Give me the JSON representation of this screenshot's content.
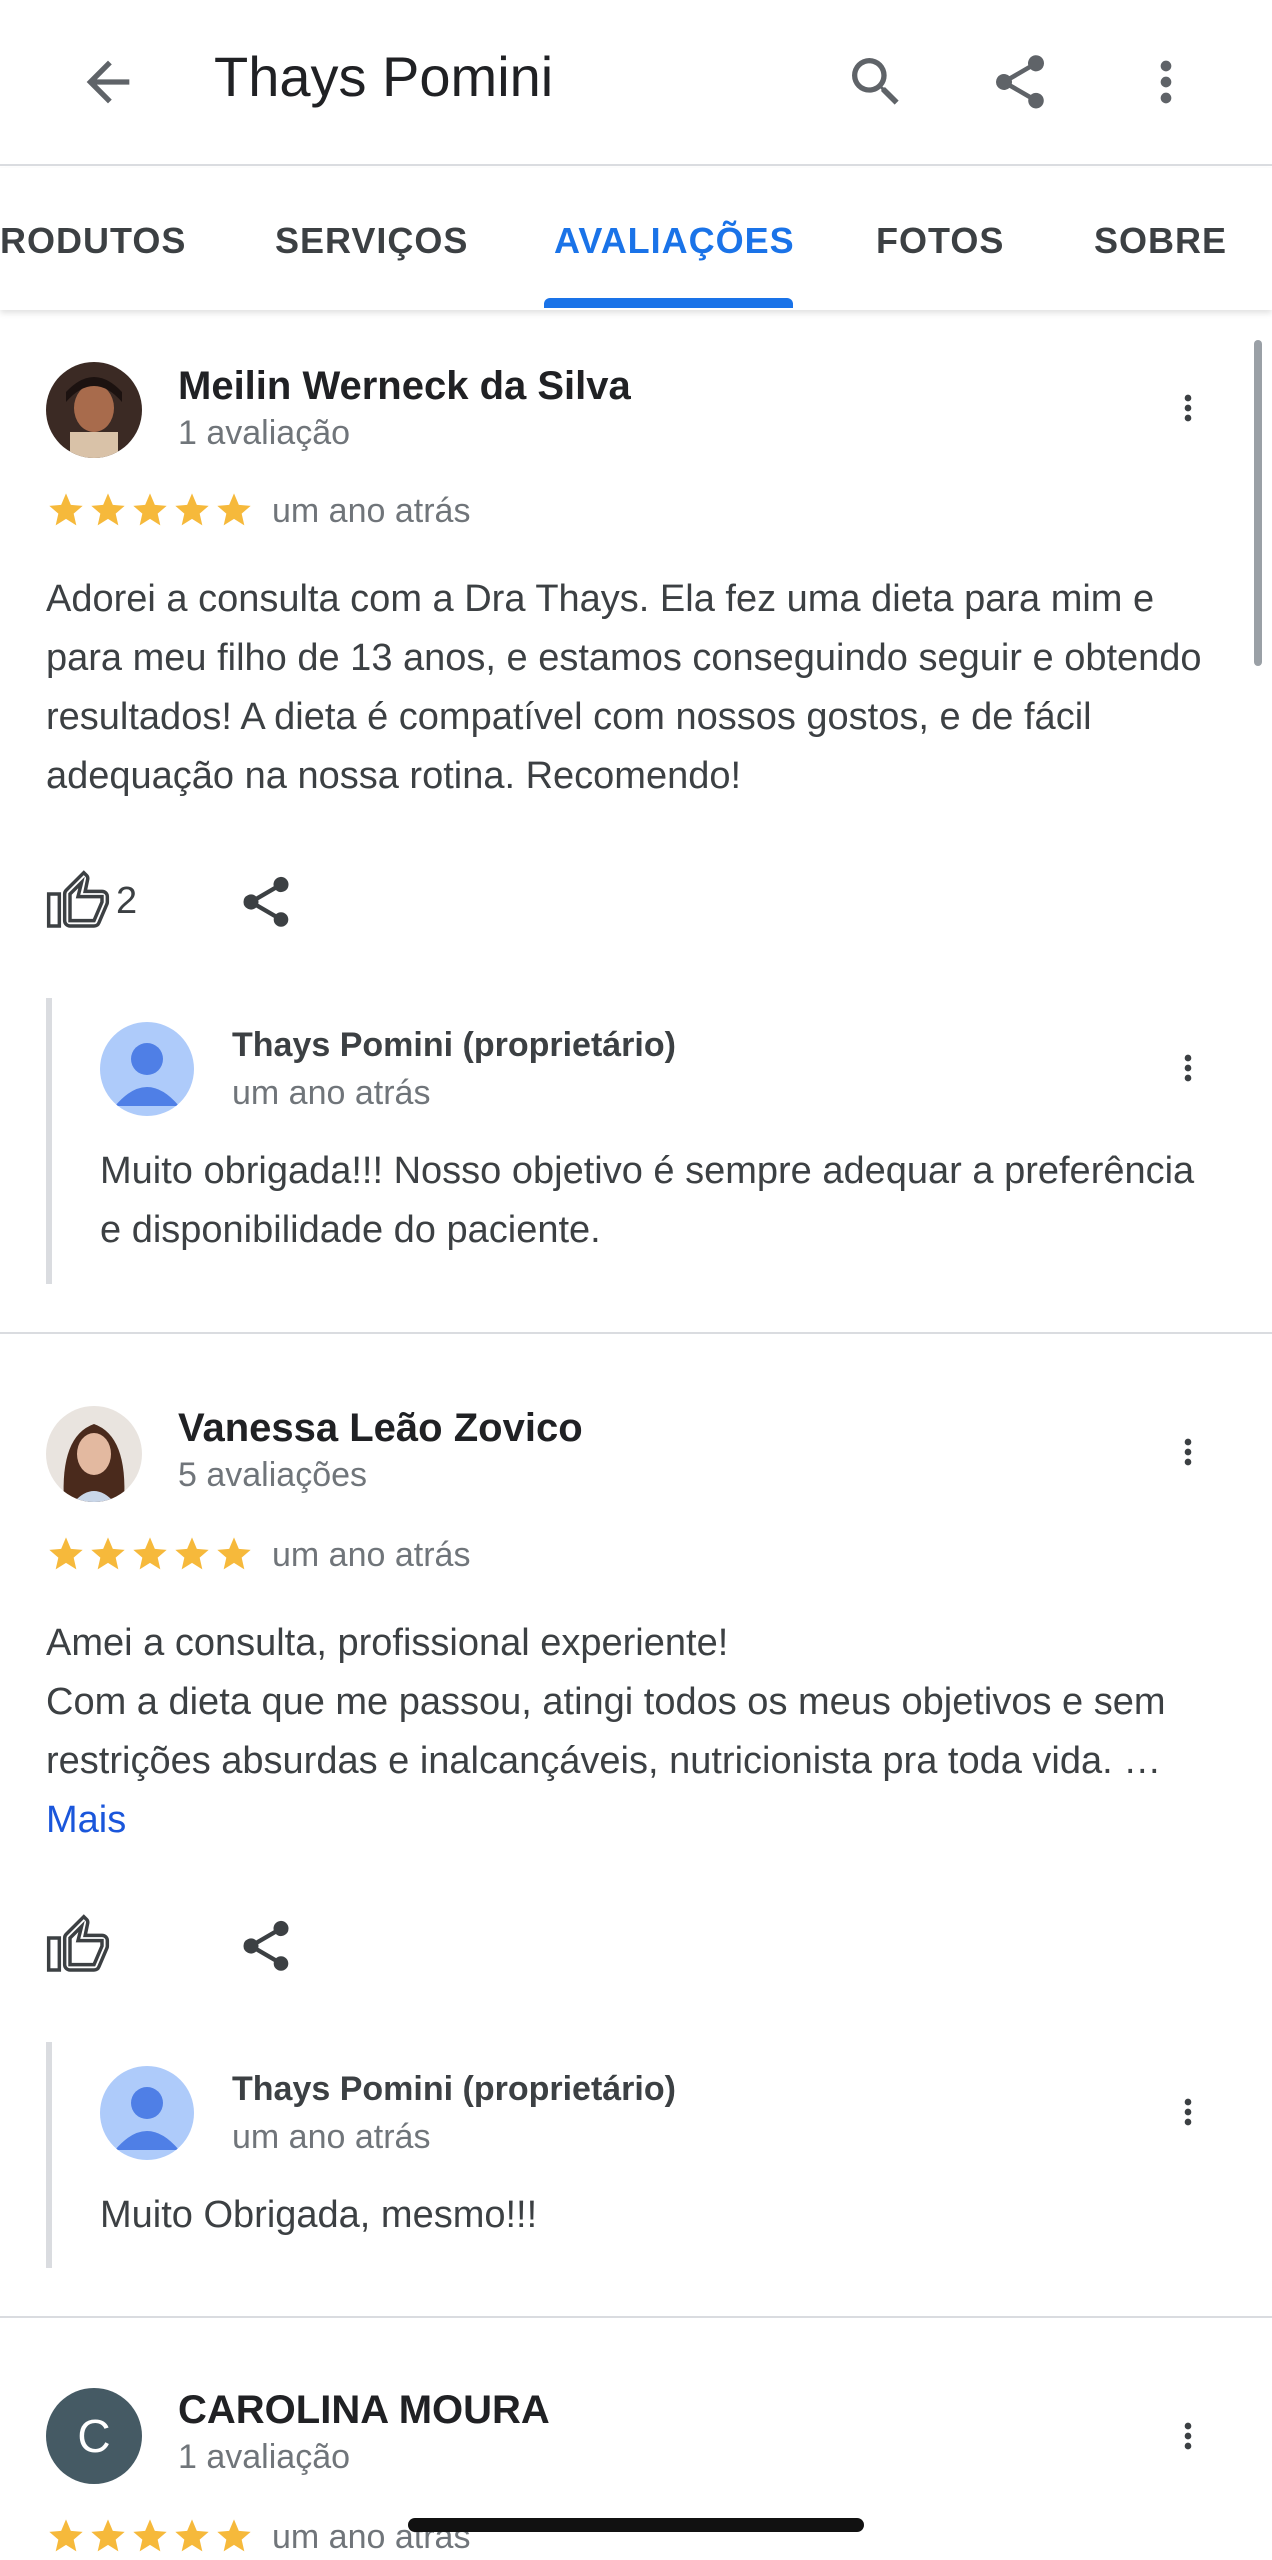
{
  "header": {
    "title": "Thays Pomini"
  },
  "tabs": [
    {
      "label": "RODUTOS"
    },
    {
      "label": "SERVIÇOS"
    },
    {
      "label": "AVALIAÇÕES",
      "active": true
    },
    {
      "label": "FOTOS"
    },
    {
      "label": "SOBRE"
    }
  ],
  "colors": {
    "accent": "#1a73e8",
    "star": "#f6b93b",
    "link": "#1a56db"
  },
  "reviews": [
    {
      "author": "Meilin Werneck da Silva",
      "review_count": "1 avaliação",
      "rating": 5,
      "date": "um ano atrás",
      "text": "Adorei a consulta com a Dra Thays. Ela fez uma dieta para mim e para meu filho de 13 anos, e estamos conseguindo seguir e obtendo resultados! A dieta é compatível com nossos gostos, e de fácil adequação na nossa rotina. Recomendo!",
      "likes": "2",
      "reply": {
        "author": "Thays Pomini (proprietário)",
        "date": "um ano atrás",
        "text": "Muito obrigada!!! Nosso objetivo é sempre adequar a preferência e disponibilidade do paciente."
      }
    },
    {
      "author": "Vanessa Leão Zovico",
      "review_count": "5 avaliações",
      "rating": 5,
      "date": "um ano atrás",
      "text_line1": "Amei a consulta, profissional experiente!",
      "text_line2": "Com a dieta que me passou, atingi todos os meus objetivos e sem restrições absurdas e inalcançáveis, nutricionista pra toda vida. …",
      "more_label": "Mais",
      "reply": {
        "author": "Thays Pomini (proprietário)",
        "date": "um ano atrás",
        "text": "Muito Obrigada, mesmo!!!"
      }
    },
    {
      "author": "CAROLINA MOURA",
      "avatar_letter": "C",
      "review_count": "1 avaliação",
      "rating": 5,
      "date": "um ano atrás"
    }
  ]
}
